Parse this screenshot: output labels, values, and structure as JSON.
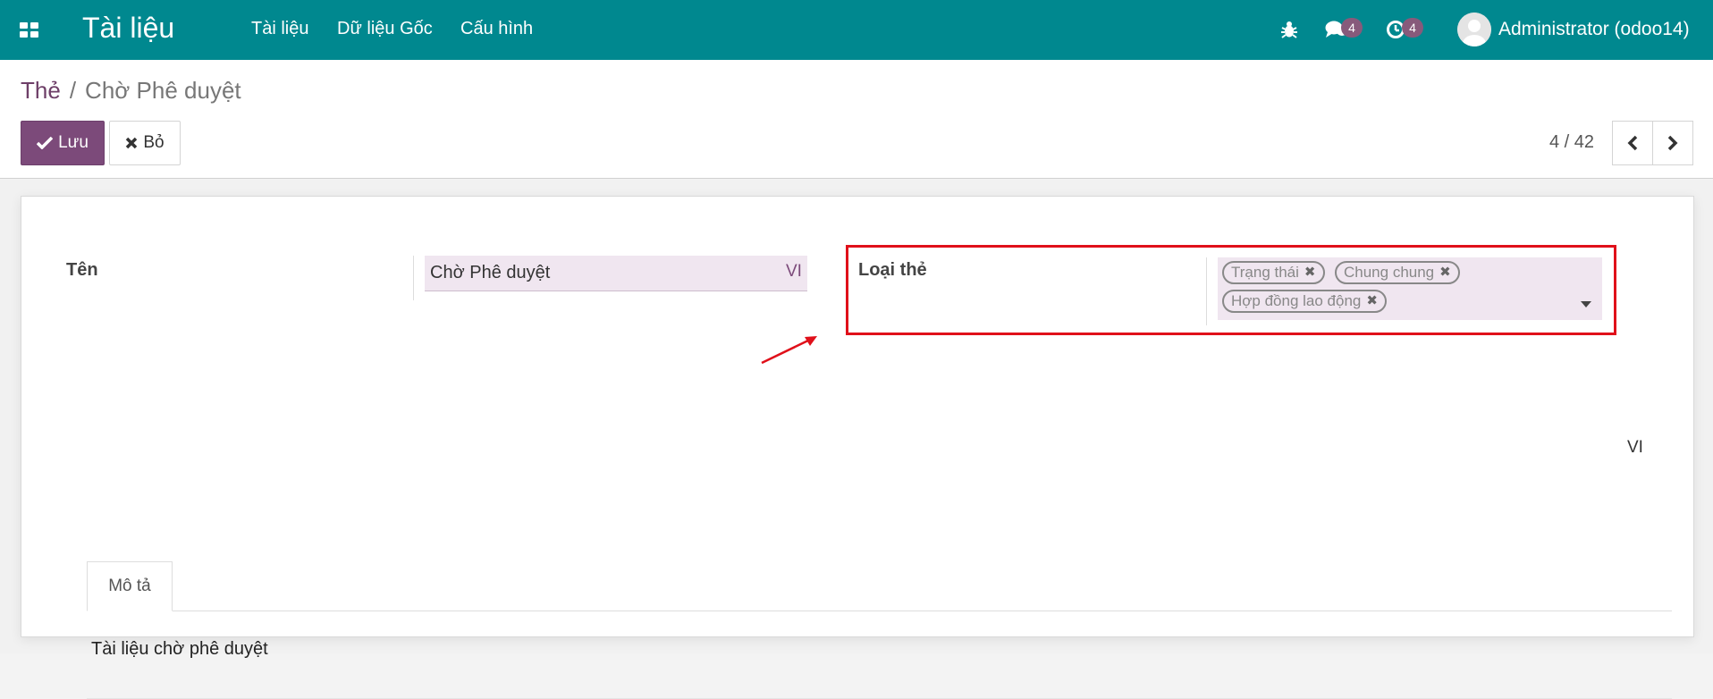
{
  "navbar": {
    "app_title": "Tài liệu",
    "menu": [
      "Tài liệu",
      "Dữ liệu Gốc",
      "Cấu hình"
    ],
    "messages_count": "4",
    "activities_count": "4",
    "user_name": "Administrator (odoo14)",
    "bg_color": "#00888f",
    "badge_color": "#875a7b"
  },
  "breadcrumb": {
    "parent": "Thẻ",
    "separator": "/",
    "current": "Chờ Phê duyệt"
  },
  "buttons": {
    "save": "Lưu",
    "discard": "Bỏ"
  },
  "pager": {
    "value": "4 / 42"
  },
  "form": {
    "name_label": "Tên",
    "name_value": "Chờ Phê duyệt",
    "lang_code": "VI",
    "tag_type_label": "Loại thẻ",
    "tag_types": [
      "Trạng thái",
      "Chung chung",
      "Hợp đồng lao động"
    ],
    "tab_label": "Mô tả",
    "description": "Tài liệu chờ phê duyệt",
    "description_lang": "VI"
  },
  "accent_color": "#7c4a7a",
  "highlight_color": "#e0101a"
}
